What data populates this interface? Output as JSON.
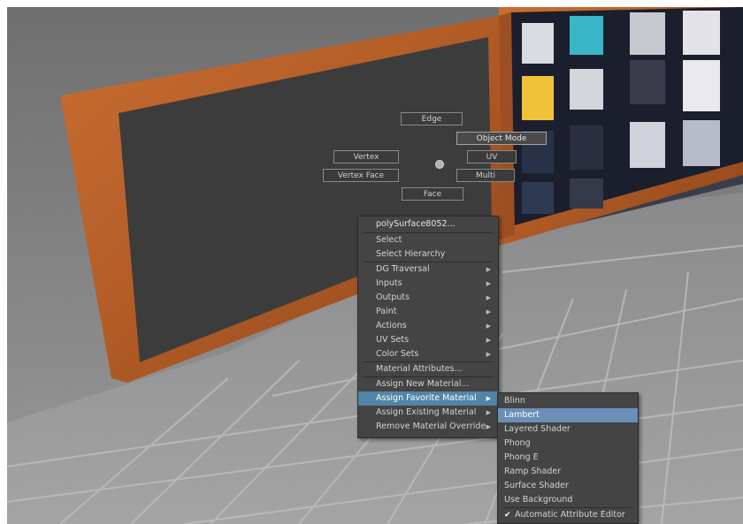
{
  "app": "Maya viewport",
  "marking_menu": {
    "north": "Edge",
    "northeast": "Object Mode",
    "west": "Vertex",
    "east": "UV",
    "southwest": "Vertex Face",
    "southeast": "Multi",
    "south": "Face"
  },
  "context_menu": {
    "object_name": "polySurface8052...",
    "items": [
      {
        "label": "Select",
        "submenu": false
      },
      {
        "label": "Select Hierarchy",
        "submenu": false
      },
      {
        "label": "DG Traversal",
        "submenu": true
      },
      {
        "label": "Inputs",
        "submenu": true
      },
      {
        "label": "Outputs",
        "submenu": true
      },
      {
        "label": "Paint",
        "submenu": true
      },
      {
        "label": "Actions",
        "submenu": true
      },
      {
        "label": "UV Sets",
        "submenu": true
      },
      {
        "label": "Color Sets",
        "submenu": true
      },
      {
        "label": "Material Attributes...",
        "submenu": false
      },
      {
        "label": "Assign New Material...",
        "submenu": false
      },
      {
        "label": "Assign Favorite Material",
        "submenu": true,
        "highlighted": true
      },
      {
        "label": "Assign Existing Material",
        "submenu": true
      },
      {
        "label": "Remove Material Override",
        "submenu": true
      }
    ]
  },
  "submenu": {
    "items": [
      {
        "label": "Blinn"
      },
      {
        "label": "Lambert",
        "highlighted": true
      },
      {
        "label": "Layered Shader"
      },
      {
        "label": "Phong"
      },
      {
        "label": "Phong E"
      },
      {
        "label": "Ramp Shader"
      },
      {
        "label": "Surface Shader"
      },
      {
        "label": "Use Background"
      }
    ],
    "checkbox_label": "Automatic Attribute Editor",
    "checkbox_checked": true
  },
  "colors": {
    "menu_bg": "#444444",
    "highlight": "#5285a6",
    "frame_wood": "#b8622b",
    "screen": "#3c3c3c"
  }
}
